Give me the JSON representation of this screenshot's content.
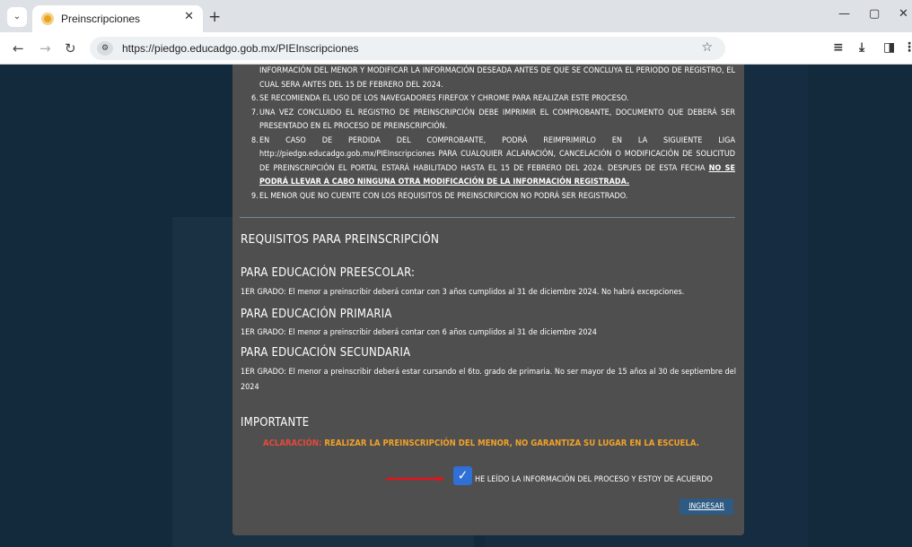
{
  "browser": {
    "tab_title": "Preinscripciones",
    "url": "https://piedgo.educadgo.gob.mx/PIEInscripciones",
    "icons": {
      "tab_menu": "chevron-down-icon",
      "close": "close-icon",
      "new_tab": "plus-icon",
      "back": "back-arrow-icon",
      "forward": "forward-arrow-icon",
      "reload": "reload-icon",
      "bookmark": "star-icon",
      "downloads": "download-icon",
      "sidepanel": "side-panel-icon"
    }
  },
  "modal": {
    "items": [
      {
        "num": "",
        "text": "INFORMACIÓN DEL MENOR Y MODIFICAR LA INFORMACIÓN DESEADA ANTES DE QUE SE CONCLUYA EL PERIODO DE REGISTRO, EL CUAL SERA ANTES DEL 15 DE FEBRERO DEL 2024."
      },
      {
        "num": "6.",
        "text": "SE RECOMIENDA EL USO DE LOS NAVEGADORES FIREFOX Y CHROME PARA REALIZAR ESTE PROCESO."
      },
      {
        "num": "7.",
        "text": "UNA VEZ CONCLUIDO EL REGISTRO DE PREINSCRIPCIÓN DEBE IMPRIMIR EL COMPROBANTE, DOCUMENTO QUE DEBERÁ SER PRESENTADO EN EL PROCESO DE PREINSCRIPCIÓN."
      },
      {
        "num": "8.",
        "text": "EN CASO DE PERDIDA DEL COMPROBANTE, PODRÁ REIMPRIMIRLO EN LA SIGUIENTE LIGA http://piedgo.educadgo.gob.mx/PIEInscripciones PARA CUALQUIER ACLARACIÓN, CANCELACIÓN O MODIFICACIÓN DE SOLICITUD DE PREINSCRIPCIÓN EL PORTAL ESTARÁ HABILITADO HASTA EL 15 DE FEBRERO DEL 2024. DESPUES DE ESTA FECHA",
        "emph": "NO SE PODRÁ LLEVAR A CABO NINGUNA OTRA MODIFICACIÓN DE LA INFORMACIÓN REGISTRADA."
      },
      {
        "num": "9.",
        "text": "EL MENOR QUE NO CUENTE CON LOS REQUISITOS DE PREINSCRIPCION NO PODRÁ SER REGISTRADO."
      }
    ],
    "requisitos_title": "REQUISITOS PARA PREINSCRIPCIÓN",
    "preescolar_title": "PARA EDUCACIÓN PREESCOLAR:",
    "preescolar_text": "1ER GRADO: El menor a preinscribir deberá contar con 3 años cumplidos al 31 de diciembre 2024. No habrá excepciones.",
    "primaria_title": "PARA EDUCACIÓN PRIMARIA",
    "primaria_text": "1ER GRADO: El menor a preinscribir deberá contar con 6 años cumplidos al 31 de diciembre 2024",
    "secundaria_title": "PARA EDUCACIÓN SECUNDARIA",
    "secundaria_text": "1ER GRADO: El menor a preinscribir deberá estar cursando el 6to. grado de primaria. No ser mayor de 15 años al 30 de septiembre del 2024",
    "importante_title": "IMPORTANTE",
    "aclaracion_label": "ACLARACIÓN:",
    "aclaracion_text": "REALIZAR LA PREINSCRIPCIÓN DEL MENOR, NO GARANTIZA SU LUGAR EN LA ESCUELA.",
    "checkbox_checked": true,
    "agree_label": "HE LEÍDO LA INFORMACIÓN DEL PROCESO Y ESTOY DE ACUERDO",
    "submit_label": "INGRESAR",
    "colors": {
      "modal_bg": "#4f4f4f",
      "aclaracion": "#e24b3b",
      "warning": "#f0a12a",
      "checkbox": "#2f6fd6",
      "button": "#2e5b83",
      "arrow": "#e0141b"
    }
  }
}
